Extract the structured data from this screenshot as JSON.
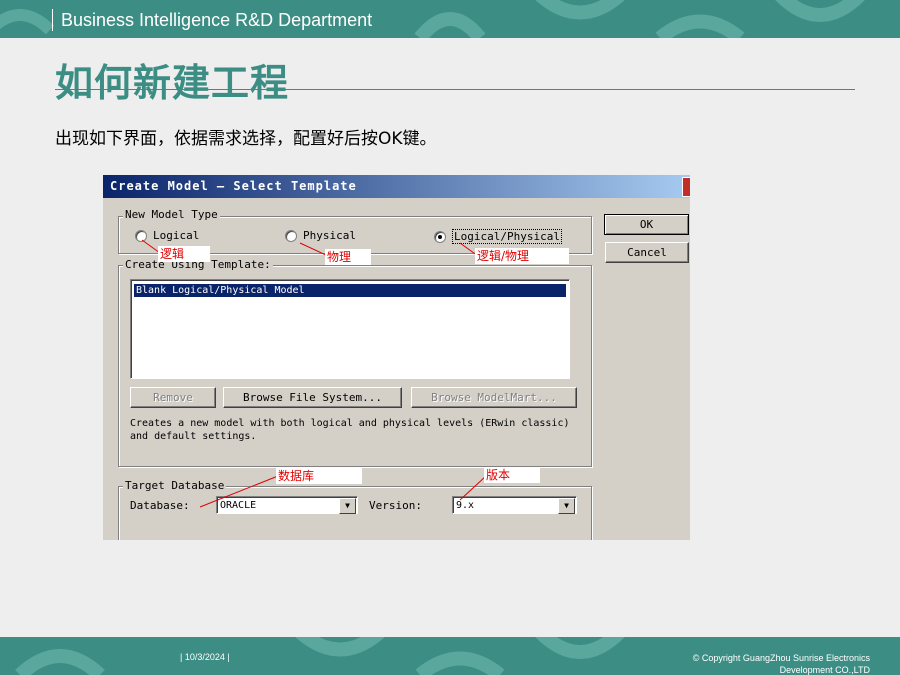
{
  "header": {
    "department": "Business Intelligence R&D Department"
  },
  "slide": {
    "title": "如何新建工程",
    "instruction": "出现如下界面，依据需求选择，配置好后按OK键。"
  },
  "footer": {
    "date": "| 10/3/2024 |",
    "copyright_line1": "© Copyright GuangZhou Sunrise Electronics",
    "copyright_line2": "Development CO.,LTD"
  },
  "dialog": {
    "title": "Create Model – Select Template",
    "model_type_group": "New Model Type",
    "radio_options": [
      {
        "label": "Logical",
        "selected": false
      },
      {
        "label": "Physical",
        "selected": false
      },
      {
        "label": "Logical/Physical",
        "selected": true
      }
    ],
    "template_group": "Create Using Template:",
    "templates": [
      "Blank Logical/Physical Model"
    ],
    "buttons": {
      "remove": "Remove",
      "browse_file": "Browse File System...",
      "browse_modelmart": "Browse ModelMart...",
      "ok": "OK",
      "cancel": "Cancel"
    },
    "description": "Creates a new model with both logical and physical levels (ERwin classic) and default settings.",
    "target_group": "Target Database",
    "database_label": "Database:",
    "database_value": "ORACLE",
    "version_label": "Version:",
    "version_value": "9.x"
  },
  "annotations": {
    "logical": "逻辑",
    "physical": "物理",
    "logical_physical": "逻辑/物理",
    "database": "数据库",
    "version": "版本"
  },
  "colors": {
    "accent": "#3c8e84",
    "title_bar": "#0a246a",
    "annotation": "#e00000"
  }
}
